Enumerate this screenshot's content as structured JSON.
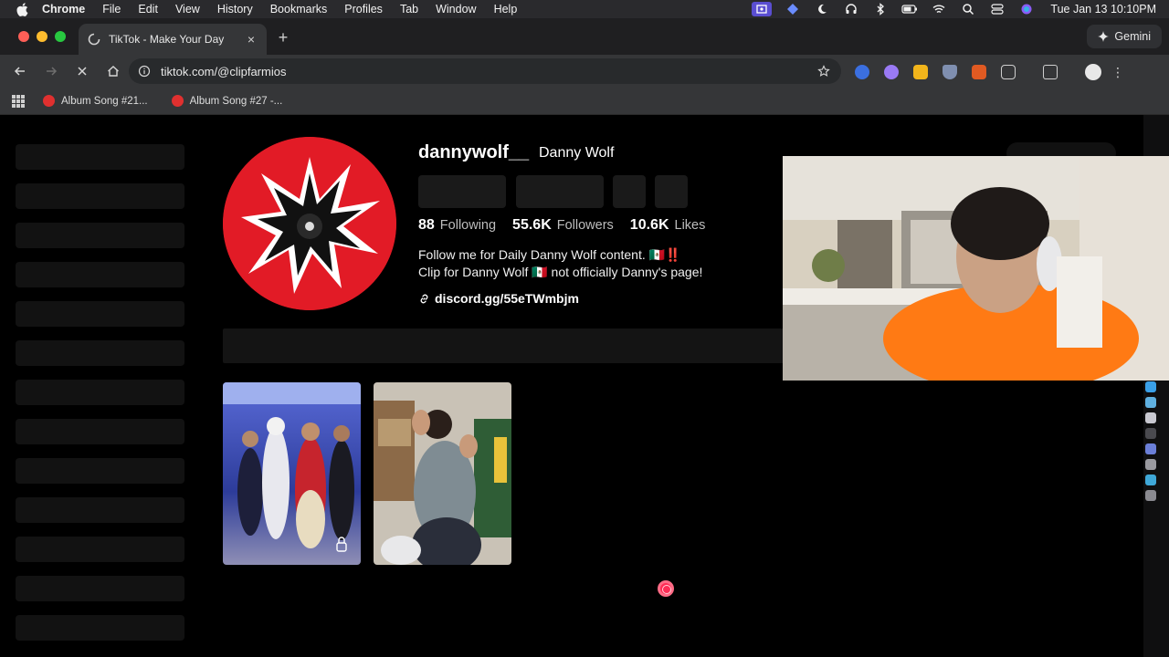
{
  "menubar": {
    "app": "Chrome",
    "menus": [
      "File",
      "Edit",
      "View",
      "History",
      "Bookmarks",
      "Profiles",
      "Tab",
      "Window",
      "Help"
    ],
    "clock": "Tue Jan 13  10:10PM"
  },
  "tab": {
    "title": "TikTok - Make Your Day"
  },
  "gemini_label": "Gemini",
  "omnibox": {
    "url": "tiktok.com/@clipfarmios"
  },
  "bookmarks": [
    {
      "label": "Album Song #21..."
    },
    {
      "label": "Album Song #27 -..."
    }
  ],
  "profile": {
    "username": "dannywolf__",
    "display_name": "Danny Wolf",
    "following_count": "88",
    "following_label": "Following",
    "followers_count": "55.6K",
    "followers_label": "Followers",
    "likes_count": "10.6K",
    "likes_label": "Likes",
    "bio_line1": "Follow me for Daily Danny Wolf content. 🇲🇽‼️",
    "bio_line2": "Clip for Danny Wolf 🇲🇽 not officially Danny's page!",
    "link": "discord.gg/55eTWmbjm"
  },
  "colors": {
    "accent": "#fe2c55",
    "avatar_bg": "#e21b26"
  }
}
